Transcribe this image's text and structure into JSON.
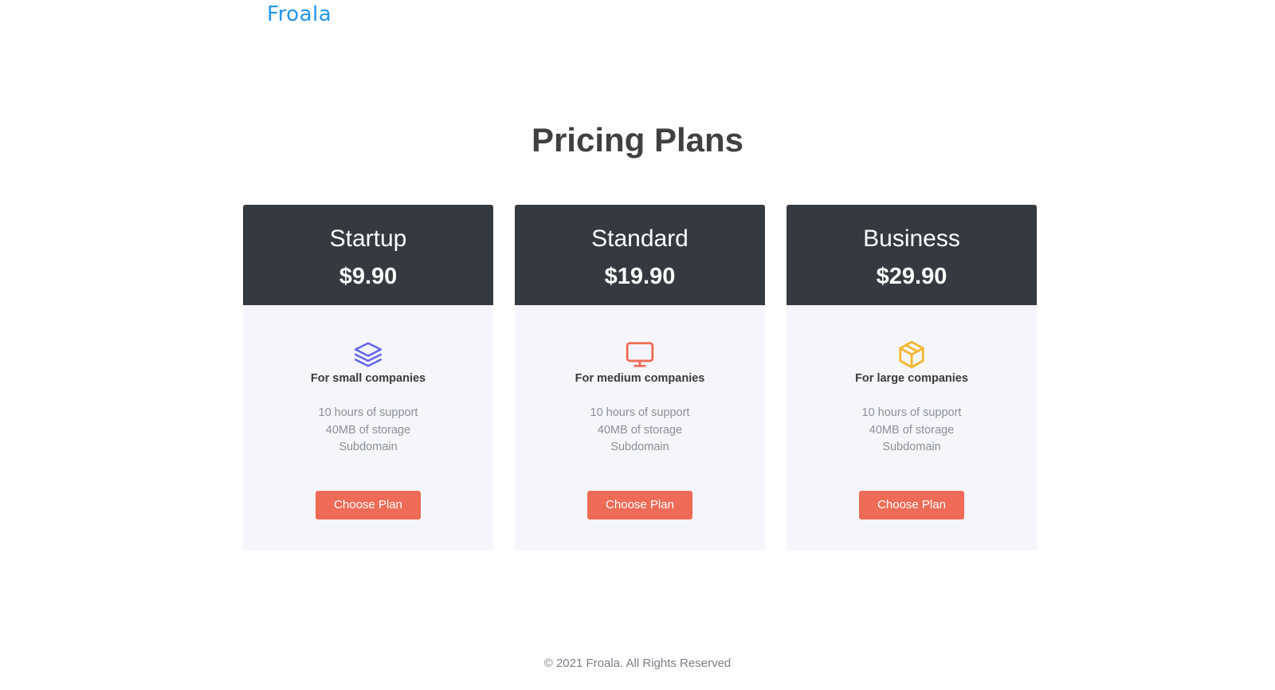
{
  "header": {
    "logo_text": "Froala"
  },
  "main": {
    "title": "Pricing Plans"
  },
  "plans": [
    {
      "name": "Startup",
      "price": "$9.90",
      "icon": "layers-icon",
      "icon_color": "#6366f1",
      "audience": "For small companies",
      "features": [
        "10 hours of support",
        "40MB of storage",
        "Subdomain"
      ],
      "button_label": "Choose Plan"
    },
    {
      "name": "Standard",
      "price": "$19.90",
      "icon": "monitor-icon",
      "icon_color": "#ee6b57",
      "audience": "For medium companies",
      "features": [
        "10 hours of support",
        "40MB of storage",
        "Subdomain"
      ],
      "button_label": "Choose Plan"
    },
    {
      "name": "Business",
      "price": "$29.90",
      "icon": "box-icon",
      "icon_color": "#f5b731",
      "audience": "For large companies",
      "features": [
        "10 hours of support",
        "40MB of storage",
        "Subdomain"
      ],
      "button_label": "Choose Plan"
    }
  ],
  "footer": {
    "text": "© 2021 Froala. All Rights Reserved"
  },
  "colors": {
    "brand": "#2196e8",
    "card_header": "#343a40",
    "card_body": "#f5f6fb",
    "button": "#ee6b57"
  }
}
